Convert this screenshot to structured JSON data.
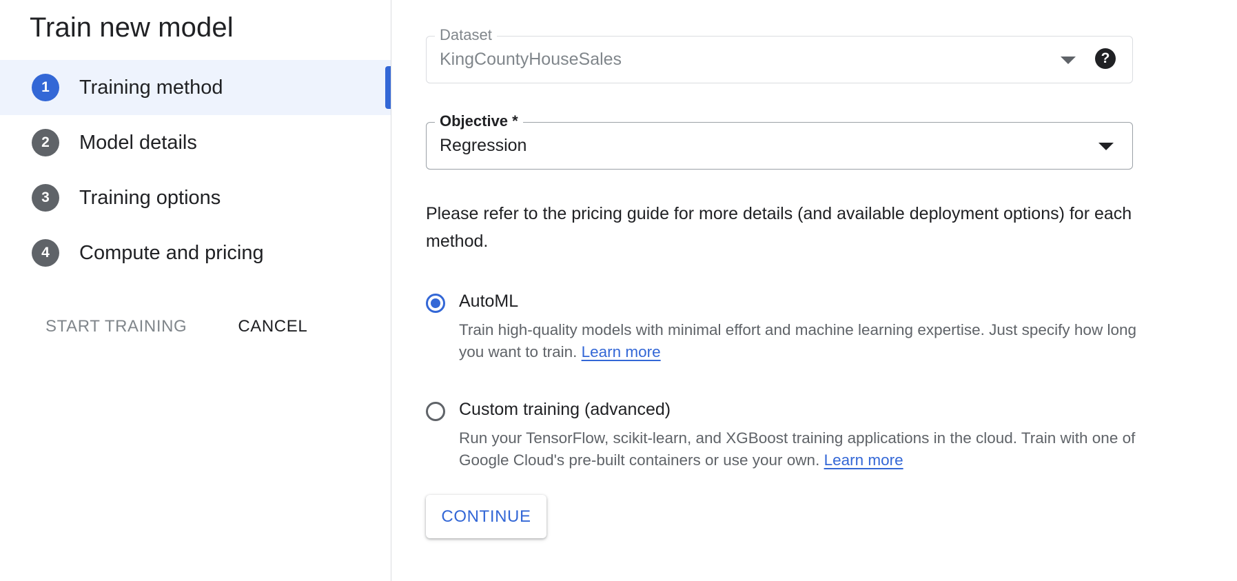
{
  "page": {
    "title": "Train new model"
  },
  "steps": [
    {
      "number": "1",
      "label": "Training method",
      "active": true
    },
    {
      "number": "2",
      "label": "Model details",
      "active": false
    },
    {
      "number": "3",
      "label": "Training options",
      "active": false
    },
    {
      "number": "4",
      "label": "Compute and pricing",
      "active": false
    }
  ],
  "actions": {
    "start_training": "START TRAINING",
    "cancel": "CANCEL"
  },
  "dataset": {
    "label": "Dataset",
    "value": "KingCountyHouseSales",
    "help_icon": "?"
  },
  "objective": {
    "label": "Objective *",
    "value": "Regression"
  },
  "note": "Please refer to the pricing guide for more details (and available deployment options) for each method.",
  "options": {
    "automl": {
      "title": "AutoML",
      "description": "Train high-quality models with minimal effort and machine learning expertise. Just specify how long you want to train.",
      "link": "Learn more",
      "selected": true
    },
    "custom": {
      "title": "Custom training (advanced)",
      "description": "Run your TensorFlow, scikit-learn, and XGBoost training applications in the cloud. Train with one of Google Cloud's pre-built containers or use your own.",
      "link": "Learn more",
      "selected": false
    }
  },
  "continue_label": "CONTINUE",
  "colors": {
    "accent": "#3367d6",
    "active_step_bg": "#eef3fd",
    "inactive_step": "#5f6368"
  },
  "icons": {
    "dropdown": "caret-down-icon",
    "help": "help-circle-icon"
  }
}
